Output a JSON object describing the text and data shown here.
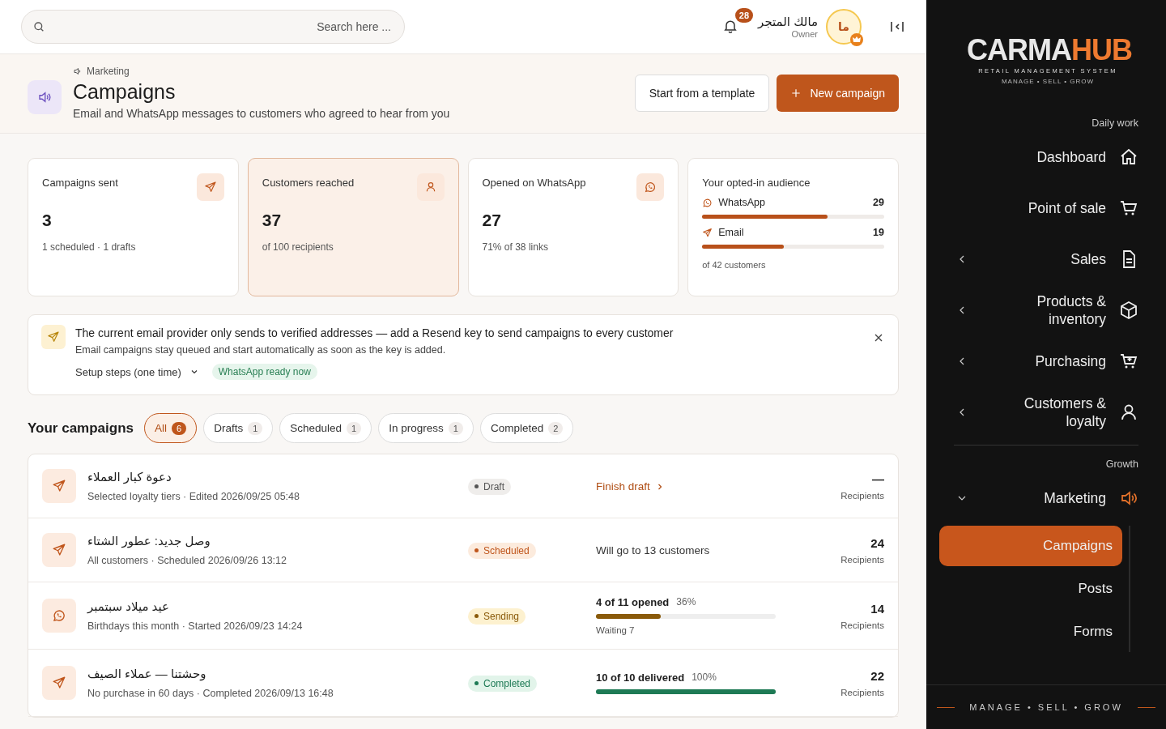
{
  "topbar": {
    "search": {
      "placeholder": "... Search here"
    },
    "notifications": {
      "count": "28"
    },
    "user": {
      "name": "مالك المتجر",
      "role": "Owner",
      "initials": "ما"
    }
  },
  "header": {
    "breadcrumb": "Marketing",
    "title": "Campaigns",
    "subtitle": "Email and WhatsApp messages to customers who agreed to hear from you",
    "buttons": [
      {
        "label": "Start from a template",
        "kind": "secondary"
      },
      {
        "label": "New campaign",
        "kind": "primary"
      }
    ]
  },
  "stats": [
    {
      "label": "Campaigns sent",
      "value": "3",
      "note": "1 scheduled · 1 drafts",
      "selected": false
    },
    {
      "label": "Customers reached",
      "value": "37",
      "note": "of 100 recipients",
      "selected": true
    },
    {
      "label": "Opened on WhatsApp",
      "value": "27",
      "note": "71% of 38 links",
      "selected": false
    }
  ],
  "audience": {
    "title": "Your opted-in audience",
    "channels": [
      {
        "name": "WhatsApp",
        "count": "29",
        "level": 0.69
      },
      {
        "name": "Email",
        "count": "19",
        "level": 0.45
      }
    ],
    "note": "of 42 customers"
  },
  "notice": {
    "title": "The current email provider only sends to verified addresses — add a Resend key to send campaigns to every customer",
    "body": "Email campaigns stay queued and start automatically as soon as the key is added.",
    "setup": "Setup steps (one time)",
    "expanded": false,
    "badge": "WhatsApp ready now"
  },
  "campaigns": {
    "title": "Your campaigns",
    "filters": [
      {
        "label": "All",
        "count": "6",
        "selected": true
      },
      {
        "label": "Drafts",
        "count": "1",
        "selected": false
      },
      {
        "label": "Scheduled",
        "count": "1",
        "selected": false
      },
      {
        "label": "In progress",
        "count": "1",
        "selected": false
      },
      {
        "label": "Completed",
        "count": "2",
        "selected": false
      }
    ],
    "rows": [
      {
        "kind": "email",
        "name": "دعوة كبار العملاء",
        "meta": "Selected loyalty tiers · Edited 2026/09/25 05:48",
        "status": "Draft",
        "color": "#555555",
        "link": "Finish draft",
        "recipients": "—",
        "recipients_label": "Recipients"
      },
      {
        "kind": "email",
        "name": "وصل جديد: عطور الشتاء",
        "meta": "All customers · Scheduled 2026/09/26 13:12",
        "status": "Scheduled",
        "color": "#c0561c",
        "detail": "Will go to 13 customers",
        "recipients": "24",
        "recipients_label": "Recipients"
      },
      {
        "kind": "whatsapp",
        "name": "عيد ميلاد سبتمبر",
        "meta": "Birthdays this month · Started 2026/09/23 14:24",
        "status": "Sending",
        "color": "#8a5a0a",
        "detail": "4 of 11 opened",
        "percent": "36%",
        "level": 0.36,
        "sub": "Waiting 7",
        "recipients": "14",
        "recipients_label": "Recipients"
      },
      {
        "kind": "email",
        "name": "وحشتنا — عملاء الصيف",
        "meta": "No purchase in 60 days · Completed 2026/09/13 16:48",
        "status": "Completed",
        "color": "#1e7a55",
        "detail": "10 of 10 delivered",
        "percent": "100%",
        "level": 1,
        "recipients": "22",
        "recipients_label": "Recipients"
      }
    ]
  },
  "sidebar": {
    "logo": {
      "brand_a": "CARMA",
      "brand_b": "HUB",
      "tagline": "RETAIL MANAGEMENT SYSTEM",
      "motto": "MANAGE • SELL • GROW"
    },
    "sections": [
      {
        "title": "Daily work",
        "items": [
          {
            "label": "Dashboard"
          },
          {
            "label": "Point of sale"
          },
          {
            "label": "Sales",
            "expanded": false
          },
          {
            "label": "Products & inventory",
            "expanded": false
          },
          {
            "label": "Purchasing",
            "expanded": false
          },
          {
            "label": "Customers & loyalty",
            "expanded": false
          }
        ]
      },
      {
        "title": "Growth",
        "items": [
          {
            "label": "Marketing",
            "expanded": true,
            "children": [
              {
                "label": "Campaigns",
                "selected": true
              },
              {
                "label": "Posts",
                "selected": false
              },
              {
                "label": "Forms",
                "selected": false
              }
            ]
          }
        ]
      }
    ],
    "footer": "MANAGE • SELL • GROW"
  }
}
